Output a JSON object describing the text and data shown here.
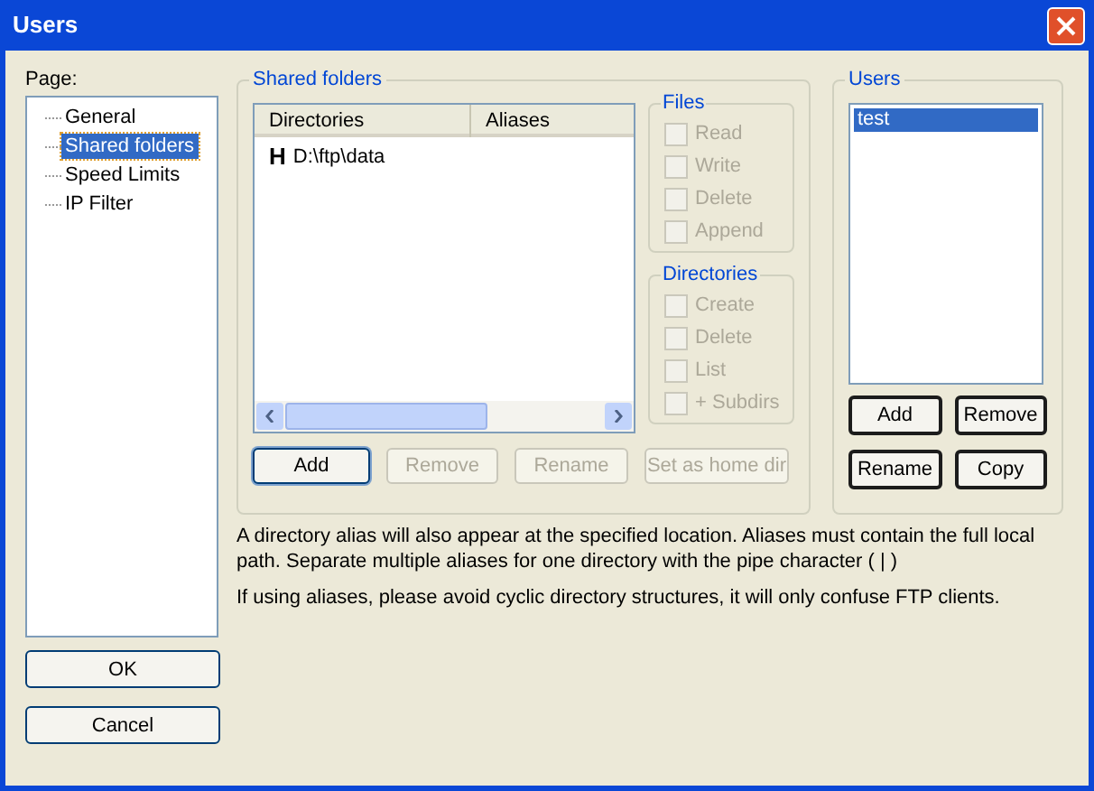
{
  "window": {
    "title": "Users"
  },
  "page_label": "Page:",
  "pages": [
    {
      "label": "General",
      "selected": false
    },
    {
      "label": "Shared folders",
      "selected": true
    },
    {
      "label": "Speed Limits",
      "selected": false
    },
    {
      "label": "IP Filter",
      "selected": false
    }
  ],
  "shared_folders": {
    "title": "Shared folders",
    "columns": [
      "Directories",
      "Aliases"
    ],
    "rows": [
      {
        "marker": "H",
        "directory": "D:\\ftp\\data",
        "selected": false
      }
    ],
    "buttons": [
      {
        "label": "Add",
        "disabled": false
      },
      {
        "label": "Remove",
        "disabled": true
      },
      {
        "label": "Rename",
        "disabled": true
      },
      {
        "label": "Set as home dir",
        "disabled": true
      }
    ]
  },
  "files": {
    "title": "Files",
    "options": [
      {
        "label": "Read",
        "checked": false,
        "disabled": true
      },
      {
        "label": "Write",
        "checked": false,
        "disabled": true
      },
      {
        "label": "Delete",
        "checked": false,
        "disabled": true
      },
      {
        "label": "Append",
        "checked": false,
        "disabled": true
      }
    ]
  },
  "directories": {
    "title": "Directories",
    "options": [
      {
        "label": "Create",
        "checked": false,
        "disabled": true
      },
      {
        "label": "Delete",
        "checked": false,
        "disabled": true
      },
      {
        "label": "List",
        "checked": false,
        "disabled": true
      },
      {
        "label": "+ Subdirs",
        "checked": false,
        "disabled": true
      }
    ]
  },
  "users": {
    "title": "Users",
    "items": [
      {
        "label": "test",
        "selected": true
      }
    ],
    "buttons": [
      {
        "label": "Add"
      },
      {
        "label": "Remove"
      },
      {
        "label": "Rename"
      },
      {
        "label": "Copy"
      }
    ]
  },
  "notes": [
    "A directory alias will also appear at the specified location. Aliases must contain the full local path. Separate multiple aliases for one directory with the pipe character ( | )",
    "If using aliases, please avoid cyclic directory structures, it will only confuse FTP clients."
  ],
  "dialog_buttons": [
    "OK",
    "Cancel"
  ]
}
